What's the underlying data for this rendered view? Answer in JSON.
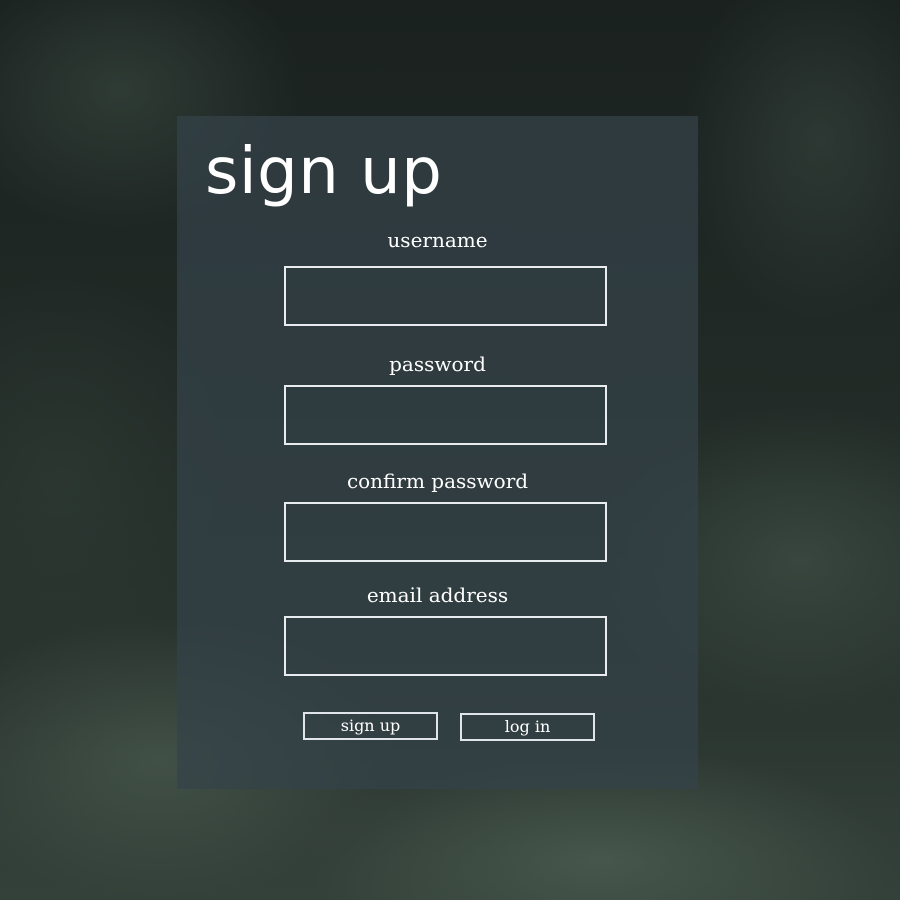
{
  "form": {
    "title": "sign up",
    "fields": [
      {
        "label": "username",
        "value": "",
        "placeholder": ""
      },
      {
        "label": "password",
        "value": "",
        "placeholder": ""
      },
      {
        "label": "confirm password",
        "value": "",
        "placeholder": ""
      },
      {
        "label": "email address",
        "value": "",
        "placeholder": ""
      }
    ],
    "buttons": {
      "signup_label": "sign up",
      "login_label": "log in"
    }
  },
  "colors": {
    "panel": "#34424a",
    "text": "#ffffff",
    "border": "#e8ecee"
  }
}
